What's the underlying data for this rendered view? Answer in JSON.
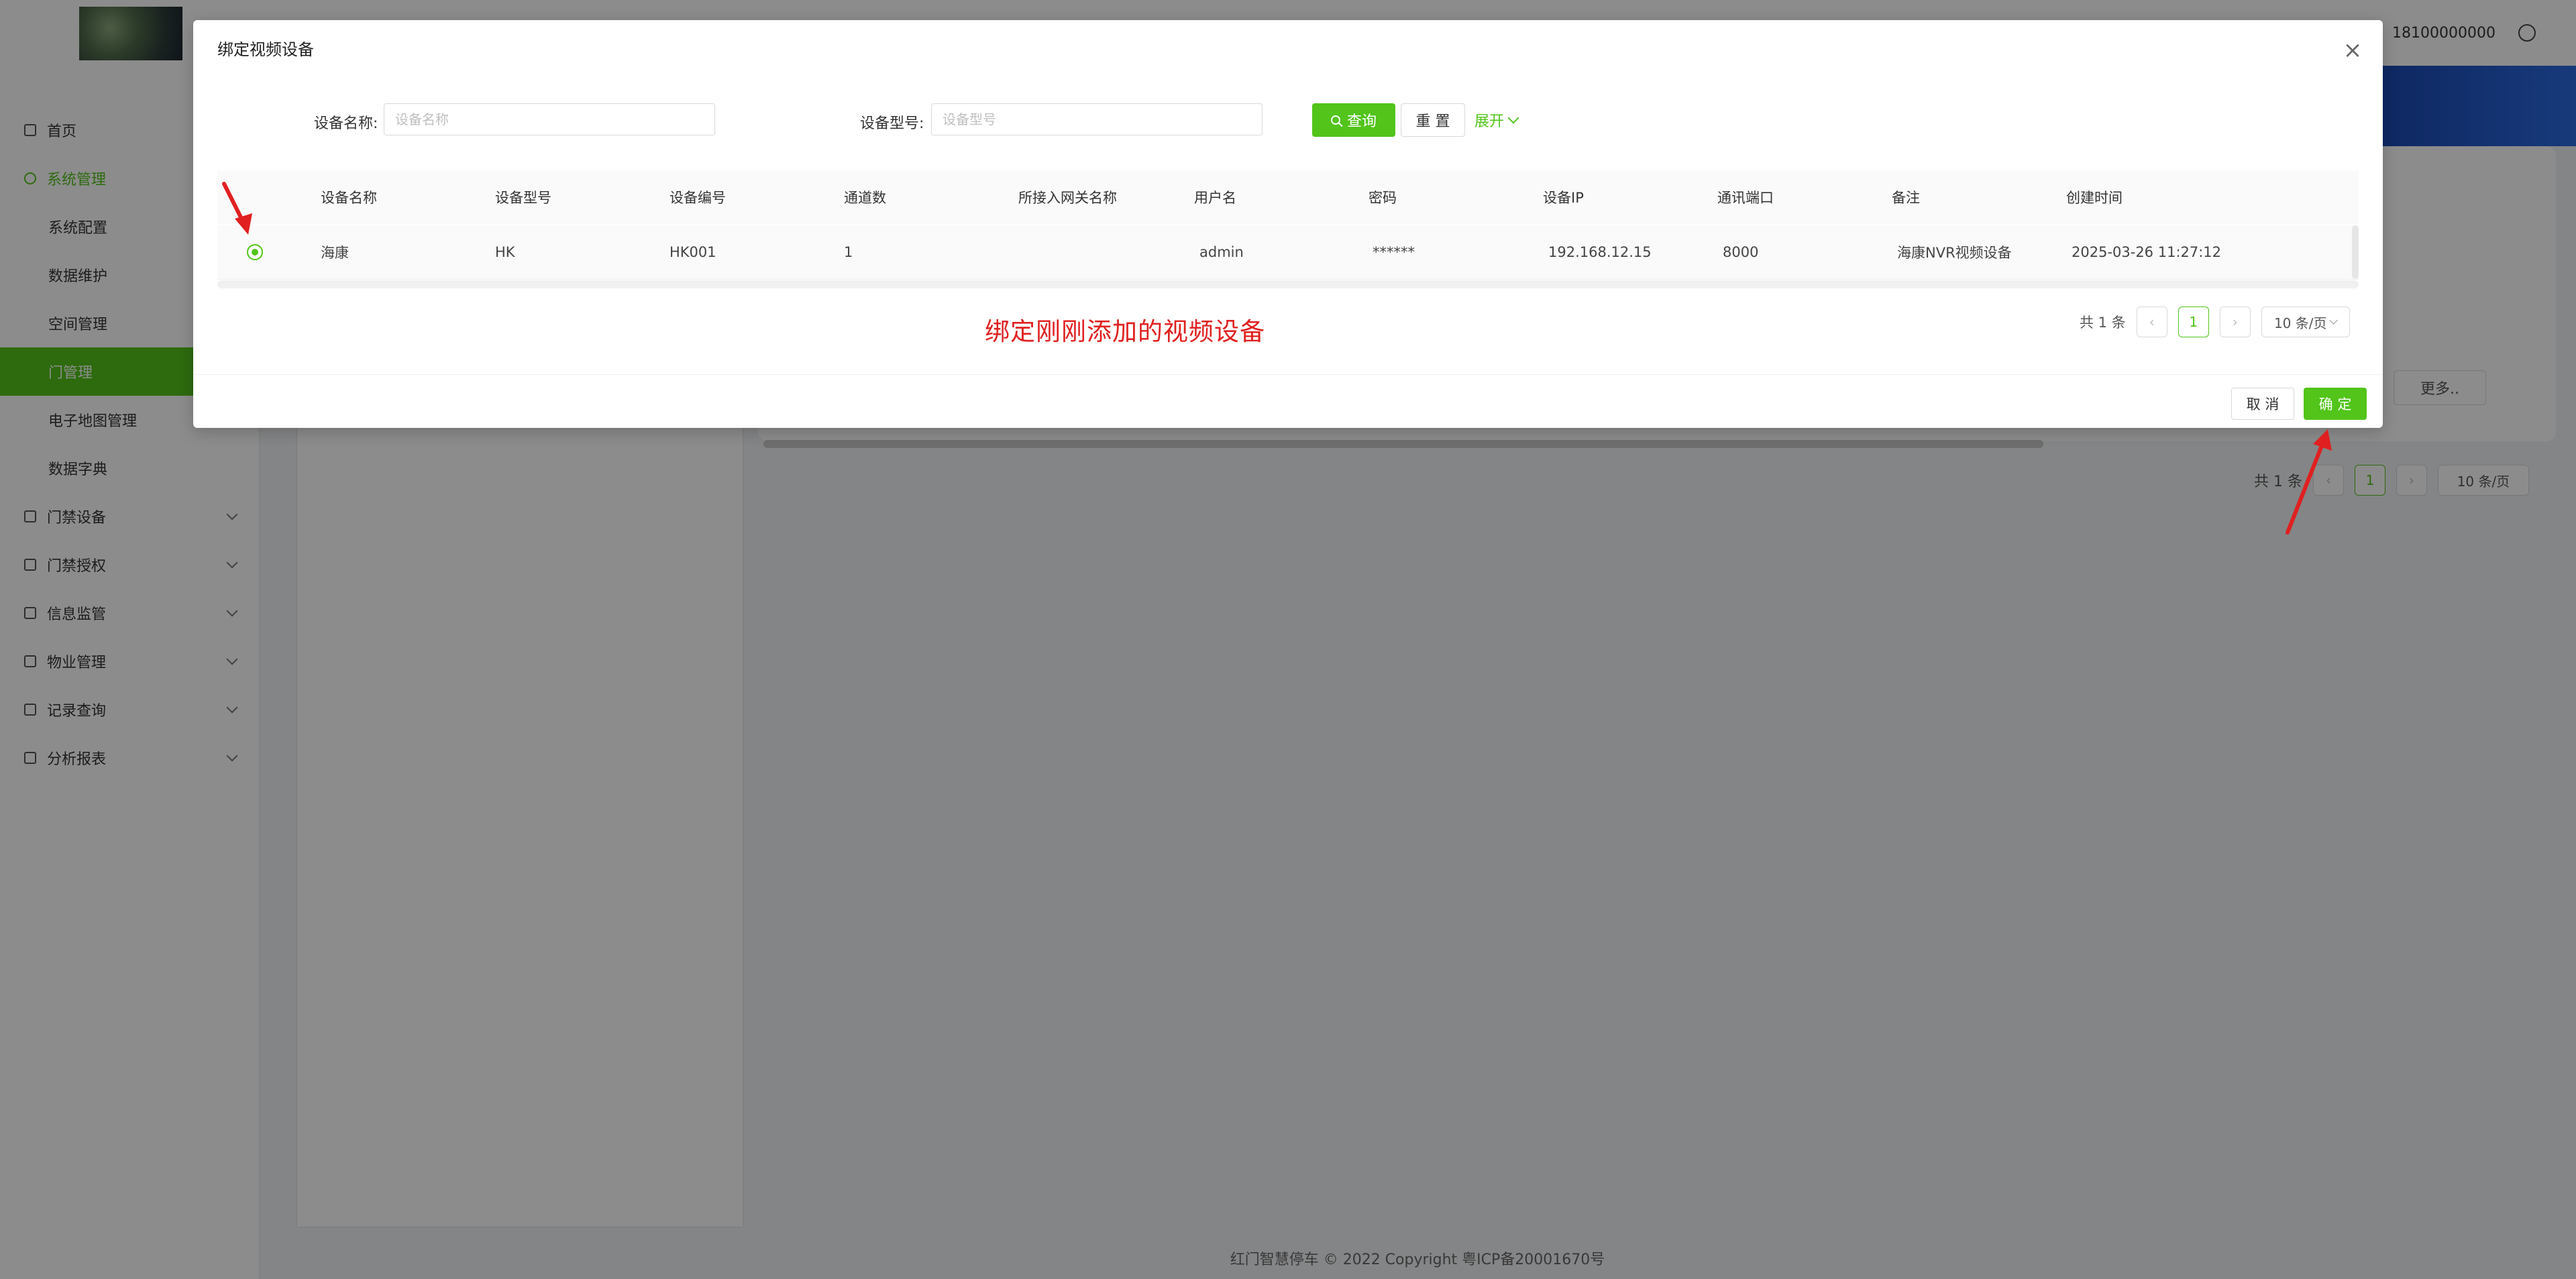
{
  "topbar": {
    "phone": "18100000000"
  },
  "sidebar": {
    "items": [
      {
        "label": "首页"
      },
      {
        "label": "系统管理"
      },
      {
        "label": "系统配置"
      },
      {
        "label": "数据维护"
      },
      {
        "label": "空间管理"
      },
      {
        "label": "门管理"
      },
      {
        "label": "电子地图管理"
      },
      {
        "label": "数据字典"
      },
      {
        "label": "门禁设备"
      },
      {
        "label": "门禁授权"
      },
      {
        "label": "信息监管"
      },
      {
        "label": "物业管理"
      },
      {
        "label": "记录查询"
      },
      {
        "label": "分析报表"
      }
    ]
  },
  "background": {
    "more_label": "更多..",
    "pagination": {
      "total": "共 1 条",
      "prev": "‹",
      "page": "1",
      "next": "›",
      "page_size": "10 条/页"
    },
    "footer": "红门智慧停车 © 2022 Copyright 粤ICP备20001670号"
  },
  "modal": {
    "title": "绑定视频设备",
    "close": "×",
    "search": {
      "name_label": "设备名称:",
      "name_placeholder": "设备名称",
      "model_label": "设备型号:",
      "model_placeholder": "设备型号",
      "query_label": "查询",
      "reset_label": "重 置",
      "expand_label": "展开"
    },
    "table": {
      "columns": [
        "设备名称",
        "设备型号",
        "设备编号",
        "通道数",
        "所接入网关名称",
        "用户名",
        "密码",
        "设备IP",
        "通讯端口",
        "备注",
        "创建时间"
      ],
      "rows": [
        {
          "selected": true,
          "name": "海康",
          "model": "HK",
          "code": "HK001",
          "channels": "1",
          "gateway": "",
          "username": "admin",
          "password": "******",
          "ip": "192.168.12.15",
          "port": "8000",
          "remark": "海康NVR视频设备",
          "created": "2025-03-26 11:27:12"
        }
      ]
    },
    "pagination": {
      "total": "共 1 条",
      "prev": "‹",
      "page": "1",
      "next": "›",
      "page_size": "10 条/页"
    },
    "annotation": "绑定刚刚添加的视频设备",
    "cancel_label": "取 消",
    "confirm_label": "确 定"
  },
  "colors": {
    "accent": "#52c41a",
    "annotation": "#e02020",
    "banner": "#1741a8"
  }
}
